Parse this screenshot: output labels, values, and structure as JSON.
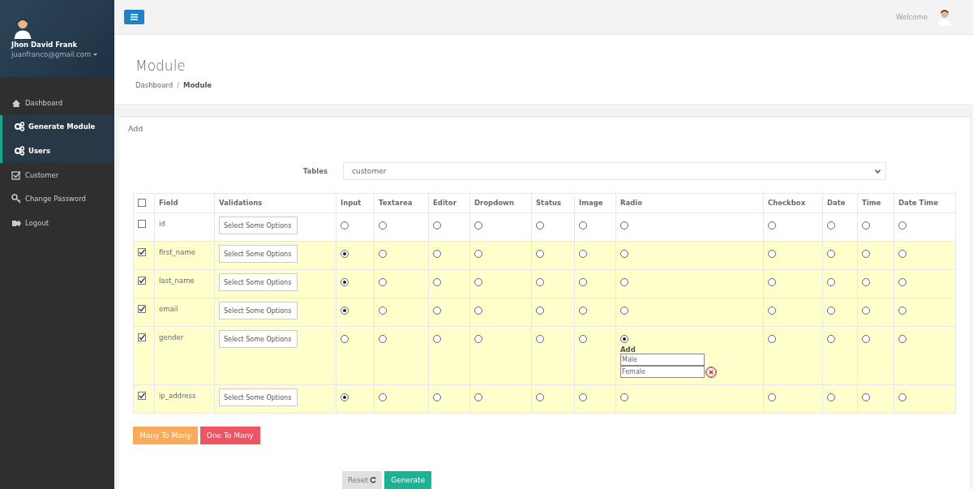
{
  "profile": {
    "name": "Jhon David Frank",
    "email": "juanfranco@gmail.com"
  },
  "nav": [
    {
      "label": "Dashboard",
      "kind": "home",
      "selected": false
    },
    {
      "label": "Generate Module",
      "kind": "module",
      "selected": true
    },
    {
      "label": "Users",
      "kind": "module",
      "selected": true
    },
    {
      "label": "Customer",
      "kind": "form",
      "selected": false
    },
    {
      "label": "Change Password",
      "kind": "password",
      "selected": false
    },
    {
      "label": "Logout",
      "kind": "logout",
      "selected": false
    }
  ],
  "topbar": {
    "welcome": "Welcome"
  },
  "header": {
    "title": "Module",
    "breadcrumb": [
      {
        "label": "Dashboard",
        "current": false
      },
      {
        "label": "Module",
        "current": true
      }
    ],
    "breadcrumb_separator": "/"
  },
  "panel": {
    "title": "Add",
    "tables_label": "Tables",
    "tables_value": "customer"
  },
  "table": {
    "all_checked": false,
    "columns": [
      "Field",
      "Validations",
      "Input",
      "Textarea",
      "Editor",
      "Dropdown",
      "Status",
      "Image",
      "Radio",
      "Checkbox",
      "Date",
      "Time",
      "Date Time"
    ],
    "rows": [
      {
        "checked": false,
        "field": "id",
        "validation": "Select Some Options",
        "types": [
          {
            "selected": false
          },
          {
            "selected": false
          },
          {
            "selected": false
          },
          {
            "selected": false
          },
          {
            "selected": false
          },
          {
            "selected": false
          },
          {
            "selected": false
          },
          {
            "selected": false
          },
          {
            "selected": false
          },
          {
            "selected": false
          },
          {
            "selected": false
          }
        ]
      },
      {
        "checked": true,
        "field": "first_name",
        "validation": "Select Some Options",
        "types": [
          {
            "selected": true
          },
          {
            "selected": false
          },
          {
            "selected": false
          },
          {
            "selected": false
          },
          {
            "selected": false
          },
          {
            "selected": false
          },
          {
            "selected": false
          },
          {
            "selected": false
          },
          {
            "selected": false
          },
          {
            "selected": false
          },
          {
            "selected": false
          }
        ]
      },
      {
        "checked": true,
        "field": "last_name",
        "validation": "Select Some Options",
        "types": [
          {
            "selected": true
          },
          {
            "selected": false
          },
          {
            "selected": false
          },
          {
            "selected": false
          },
          {
            "selected": false
          },
          {
            "selected": false
          },
          {
            "selected": false
          },
          {
            "selected": false
          },
          {
            "selected": false
          },
          {
            "selected": false
          },
          {
            "selected": false
          }
        ]
      },
      {
        "checked": true,
        "field": "email",
        "validation": "Select Some Options",
        "types": [
          {
            "selected": true
          },
          {
            "selected": false
          },
          {
            "selected": false
          },
          {
            "selected": false
          },
          {
            "selected": false
          },
          {
            "selected": false
          },
          {
            "selected": false
          },
          {
            "selected": false
          },
          {
            "selected": false
          },
          {
            "selected": false
          },
          {
            "selected": false
          }
        ]
      },
      {
        "checked": true,
        "field": "gender",
        "validation": "Select Some Options",
        "types": [
          {
            "selected": false
          },
          {
            "selected": false
          },
          {
            "selected": false
          },
          {
            "selected": false
          },
          {
            "selected": false
          },
          {
            "selected": false
          },
          {
            "selected": true
          },
          {
            "selected": false
          },
          {
            "selected": false
          },
          {
            "selected": false
          },
          {
            "selected": false
          }
        ],
        "radio_options": {
          "label": "Add",
          "values": [
            "Male",
            "Female"
          ]
        }
      },
      {
        "checked": true,
        "field": "ip_address",
        "validation": "Select Some Options",
        "types": [
          {
            "selected": true
          },
          {
            "selected": false
          },
          {
            "selected": false
          },
          {
            "selected": false
          },
          {
            "selected": false
          },
          {
            "selected": false
          },
          {
            "selected": false
          },
          {
            "selected": false
          },
          {
            "selected": false
          },
          {
            "selected": false
          },
          {
            "selected": false
          }
        ]
      }
    ]
  },
  "relation_buttons": [
    {
      "label": "Many To Many",
      "kind": "warning"
    },
    {
      "label": "One To Many",
      "kind": "danger"
    }
  ],
  "actions": {
    "reset": "Reset",
    "generate": "Generate"
  }
}
